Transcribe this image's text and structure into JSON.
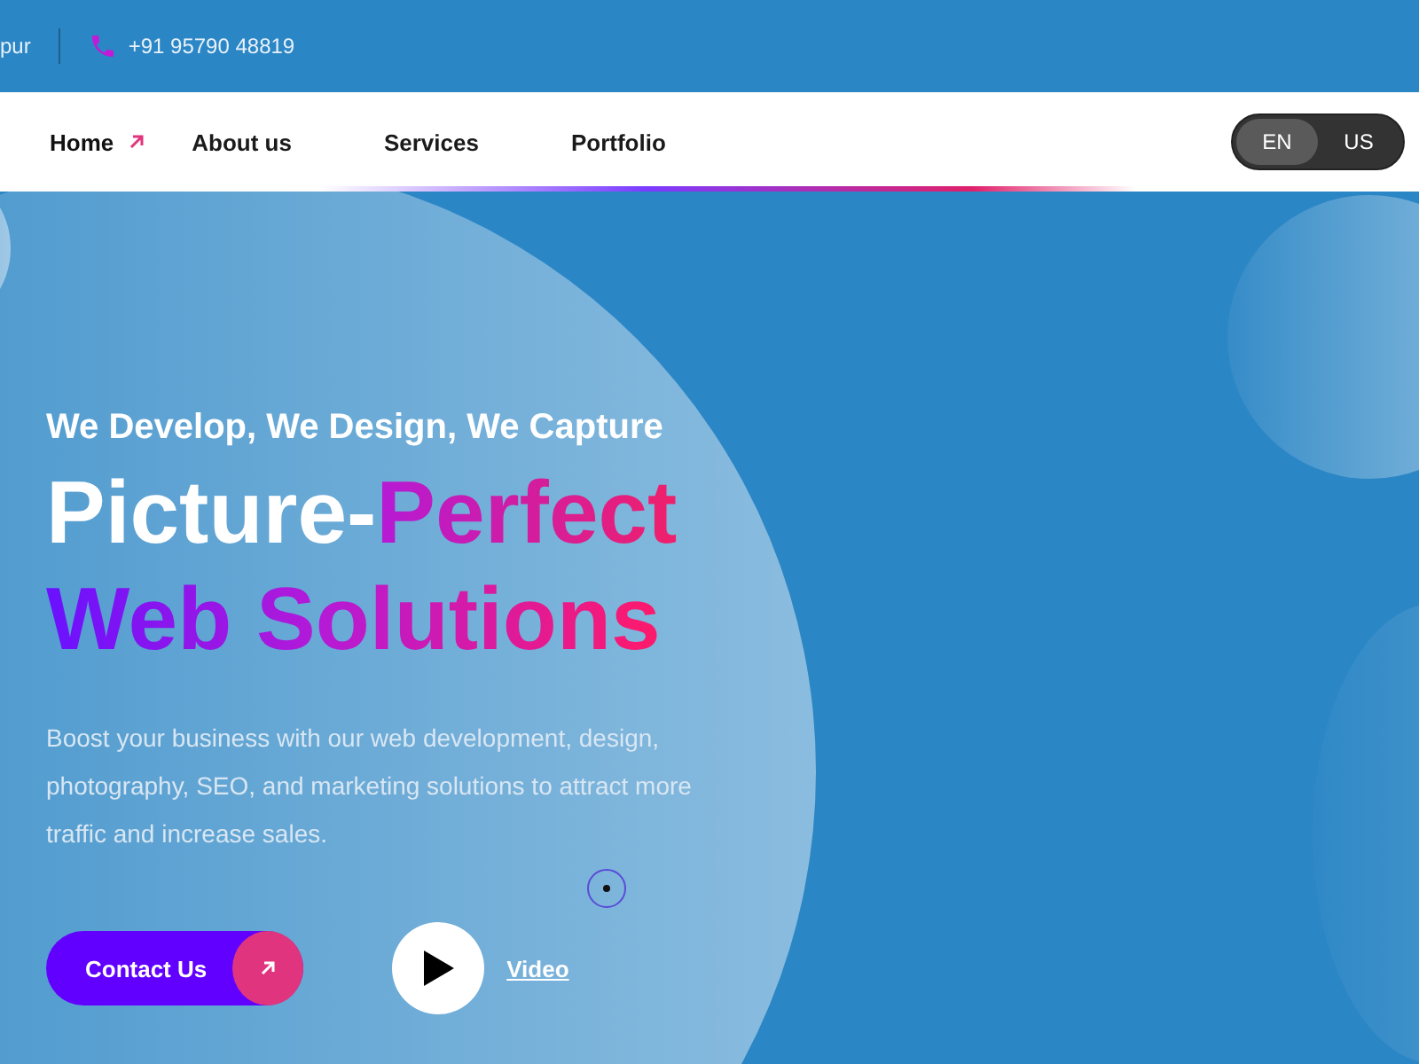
{
  "top_bar": {
    "location": "pur",
    "phone": "+91 95790 48819"
  },
  "nav": {
    "items": [
      {
        "label": "Home",
        "selected": true
      },
      {
        "label": "About us",
        "selected": false
      },
      {
        "label": "Services",
        "selected": false
      },
      {
        "label": "Portfolio",
        "selected": false
      }
    ],
    "languages": [
      {
        "label": "EN",
        "selected": true
      },
      {
        "label": "US",
        "selected": false
      }
    ]
  },
  "hero": {
    "tagline": "We Develop, We Design, We Capture",
    "headline_plain": "Picture-",
    "headline_accent": "Perfect",
    "headline_line2": "Web Solutions",
    "description": "Boost your business with our web development, design, photography, SEO, and marketing solutions to attract more traffic and increase sales.",
    "contact_button": "Contact Us",
    "video_link": "Video"
  }
}
